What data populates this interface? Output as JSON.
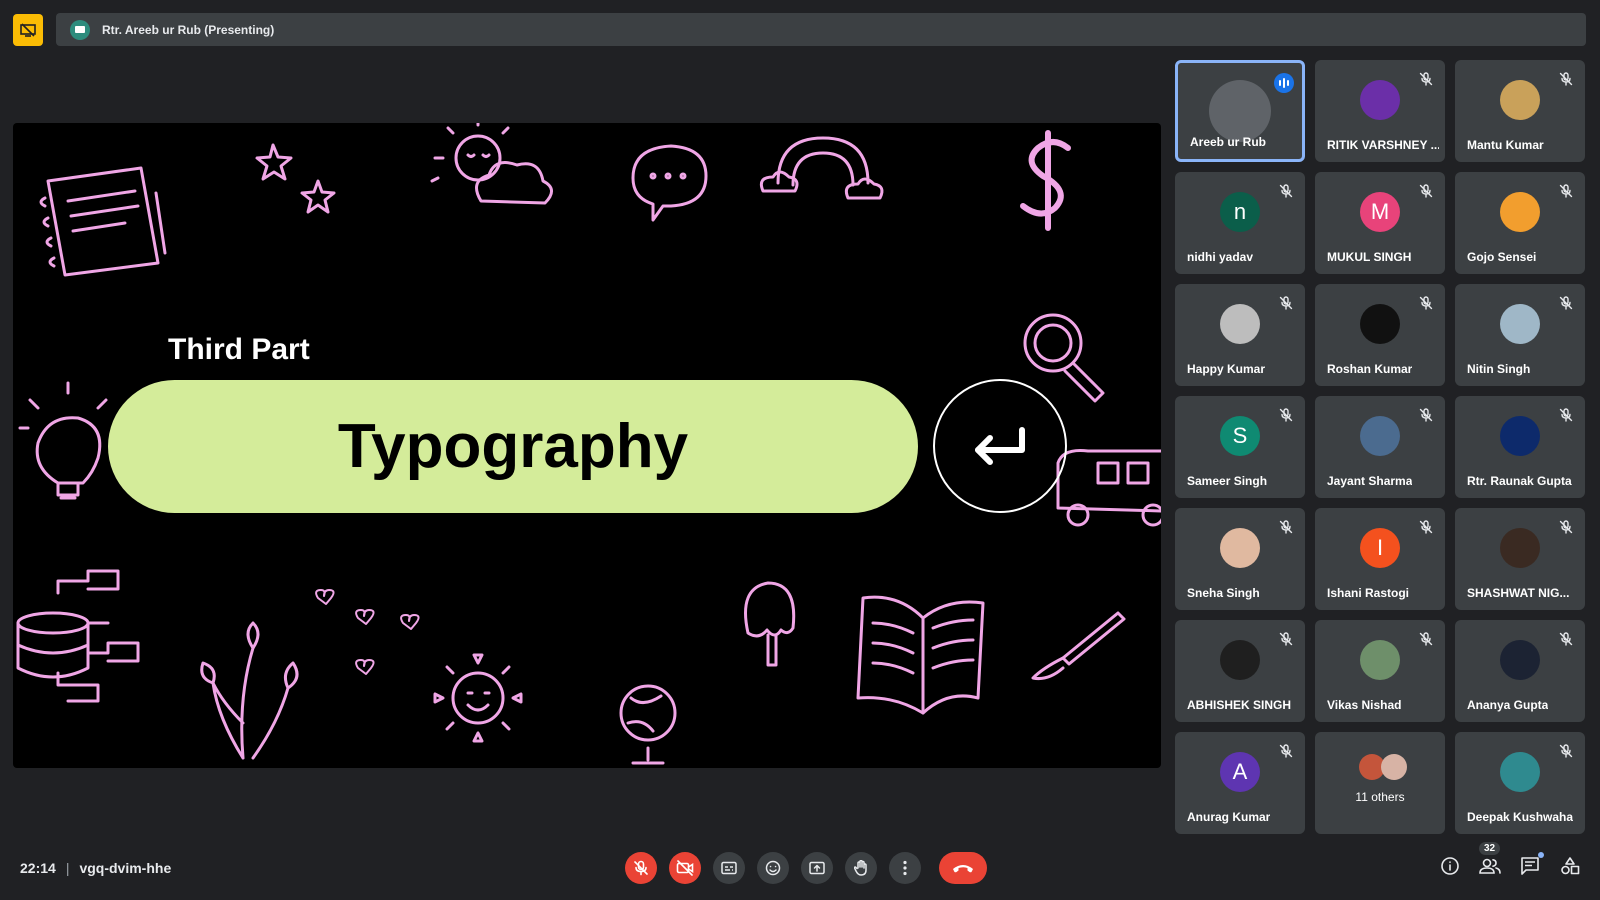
{
  "header": {
    "presenter_label": "Rtr. Areeb ur Rub (Presenting)"
  },
  "slide": {
    "subtitle": "Third Part",
    "title": "Typography",
    "accent_color": "#d4ec9a",
    "doodle_color": "#f0a6e6"
  },
  "participants": [
    {
      "name": "Areeb ur Rub",
      "speaking": true,
      "avatar_bg": "#5f6368",
      "initial": ""
    },
    {
      "name": "RITIK VARSHNEY ...",
      "avatar_bg": "#6b2fa8",
      "initial": ""
    },
    {
      "name": "Mantu Kumar",
      "avatar_bg": "#c9a15a",
      "initial": ""
    },
    {
      "name": "nidhi yadav",
      "avatar_bg": "#0b5e4a",
      "initial": "n"
    },
    {
      "name": "MUKUL SINGH",
      "avatar_bg": "#e8437a",
      "initial": "M"
    },
    {
      "name": "Gojo Sensei",
      "avatar_bg": "#f29e2e",
      "initial": ""
    },
    {
      "name": "Happy Kumar",
      "avatar_bg": "#bdbdbd",
      "initial": ""
    },
    {
      "name": "Roshan Kumar",
      "avatar_bg": "#111111",
      "initial": ""
    },
    {
      "name": "Nitin Singh",
      "avatar_bg": "#9fb7c7",
      "initial": ""
    },
    {
      "name": "Sameer Singh",
      "avatar_bg": "#0f8a72",
      "initial": "S"
    },
    {
      "name": "Jayant Sharma",
      "avatar_bg": "#4b6b8f",
      "initial": ""
    },
    {
      "name": "Rtr. Raunak Gupta",
      "avatar_bg": "#0d2a6b",
      "initial": ""
    },
    {
      "name": "Sneha Singh",
      "avatar_bg": "#e0b9a0",
      "initial": ""
    },
    {
      "name": "Ishani Rastogi",
      "avatar_bg": "#f4511e",
      "initial": "I"
    },
    {
      "name": "SHASHWAT NIG...",
      "avatar_bg": "#3a2a22",
      "initial": ""
    },
    {
      "name": "ABHISHEK SINGH",
      "avatar_bg": "#1f1f1f",
      "initial": ""
    },
    {
      "name": "Vikas Nishad",
      "avatar_bg": "#6e8f6a",
      "initial": ""
    },
    {
      "name": "Ananya Gupta",
      "avatar_bg": "#1c2333",
      "initial": ""
    },
    {
      "name": "Anurag Kumar",
      "avatar_bg": "#5e35b1",
      "initial": "A"
    },
    {
      "others": true,
      "label": "11 others"
    },
    {
      "name": "Deepak Kushwaha",
      "avatar_bg": "#2f8a8f",
      "initial": ""
    }
  ],
  "footer": {
    "time": "22:14",
    "meeting_code": "vgq-dvim-hhe",
    "participant_count": "32"
  },
  "icons": {
    "mic": "mic-off-icon",
    "camera": "camera-off-icon",
    "captions": "captions-icon",
    "emoji": "emoji-icon",
    "present": "present-icon",
    "hand": "raise-hand-icon",
    "more": "more-options-icon",
    "end": "end-call-icon",
    "info": "info-icon",
    "people": "people-icon",
    "chat": "chat-icon",
    "activities": "activities-icon"
  }
}
